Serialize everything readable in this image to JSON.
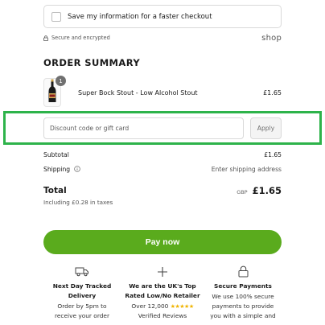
{
  "save_info": {
    "label": "Save my information for a faster checkout"
  },
  "secure": {
    "text": "Secure and encrypted",
    "shop_logo": "shop"
  },
  "summary": {
    "title": "ORDER SUMMARY",
    "item": {
      "name": "Super Bock Stout - Low Alcohol Stout",
      "quantity": "1",
      "price": "£1.65",
      "icon": "beer-bottle-icon"
    }
  },
  "discount": {
    "placeholder": "Discount code or gift card",
    "apply_label": "Apply",
    "highlight_color": "#2db34a"
  },
  "totals": {
    "subtotal_label": "Subtotal",
    "subtotal_value": "£1.65",
    "shipping_label": "Shipping",
    "shipping_value": "Enter shipping address",
    "total_label": "Total",
    "currency": "GBP",
    "total_value": "£1.65",
    "taxes_note": "Including £0.28 in taxes"
  },
  "pay": {
    "label": "Pay now",
    "color": "#5aab1d"
  },
  "features": [
    {
      "icon": "delivery-truck-icon",
      "title": "Next Day Tracked Delivery",
      "text_line1": "Order by 5pm to",
      "text_line2": "receive your order"
    },
    {
      "icon": "plus-icon",
      "title": "We are the UK's Top Rated Low/No Retailer",
      "text_prefix": "Over 12,000",
      "stars": "★★★★★",
      "text_line2": "Verified Reviews"
    },
    {
      "icon": "lock-icon",
      "title": "Secure Payments",
      "text_line1": "We use 100% secure",
      "text_line2": "payments to provide",
      "text_line3": "you with a simple and"
    }
  ]
}
